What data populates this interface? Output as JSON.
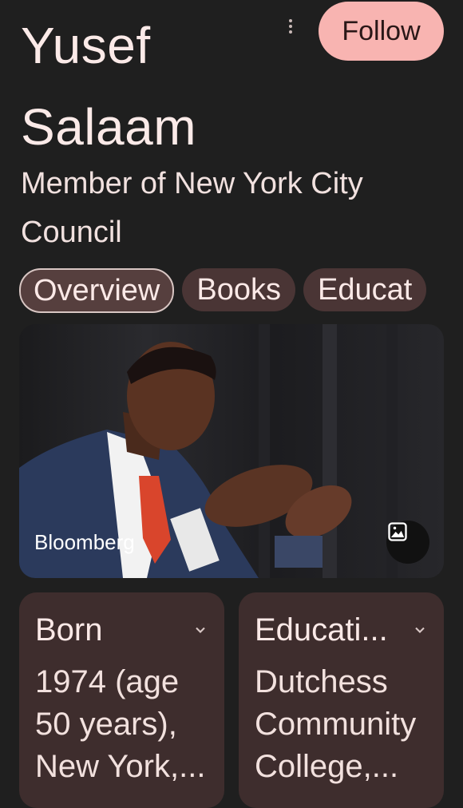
{
  "header": {
    "title": "Yusef Salaam",
    "subtitle": "Member of New York City Council",
    "follow_label": "Follow"
  },
  "tabs": [
    {
      "label": "Overview",
      "active": true
    },
    {
      "label": "Books",
      "active": false
    },
    {
      "label": "Educat",
      "active": false
    }
  ],
  "image": {
    "source": "Bloomberg",
    "icon": "image-icon"
  },
  "cards": [
    {
      "label": "Born",
      "value": "1974 (age 50 years), New York,...",
      "icon": "chevron-down-icon"
    },
    {
      "label": "Educati...",
      "value": "Dutchess Community College,...",
      "icon": "chevron-down-icon"
    }
  ],
  "colors": {
    "background": "#1f1f1f",
    "follow_button": "#f8b4b1",
    "tab_background": "#4a3535",
    "card_background": "#3e2d2d"
  }
}
